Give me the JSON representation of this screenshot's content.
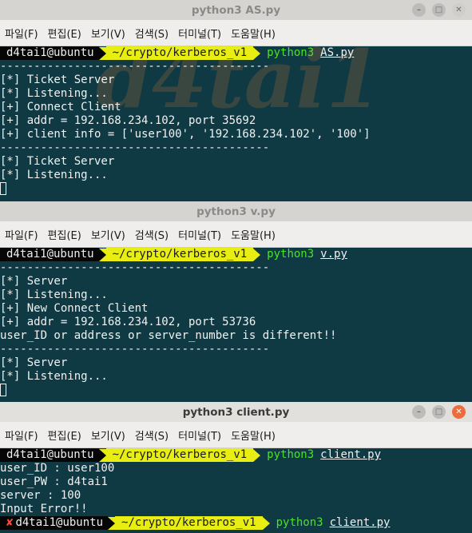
{
  "menu": [
    "파일(F)",
    "편집(E)",
    "보기(V)",
    "검색(S)",
    "터미널(T)",
    "도움말(H)"
  ],
  "windows": {
    "as": {
      "title": "python3 AS.py",
      "prompt": {
        "host": "d4tai1@ubuntu",
        "path": "~/crypto/kerberos_v1",
        "cmd": "python3",
        "arg": "AS.py"
      },
      "lines": [
        "----------------------------------------",
        "[*] Ticket Server",
        "[*] Listening...",
        "[+] Connect Client",
        "[+] addr = 192.168.234.102, port 35692",
        "[+] client info = ['user100', '192.168.234.102', '100']",
        "----------------------------------------",
        "[*] Ticket Server",
        "[*] Listening..."
      ]
    },
    "v": {
      "title": "python3 v.py",
      "prompt": {
        "host": "d4tai1@ubuntu",
        "path": "~/crypto/kerberos_v1",
        "cmd": "python3",
        "arg": "v.py"
      },
      "lines": [
        "----------------------------------------",
        "[*] Server",
        "[*] Listening...",
        "[+] New Connect Client",
        "[+] addr = 192.168.234.102, port 53736",
        "user_ID or address or server_number is different!!",
        "----------------------------------------",
        "[*] Server",
        "[*] Listening..."
      ]
    },
    "client": {
      "title": "python3 client.py",
      "prompt": {
        "host": "d4tai1@ubuntu",
        "path": "~/crypto/kerberos_v1",
        "cmd": "python3",
        "arg": "client.py"
      },
      "lines": [
        "user_ID : user100",
        "user_PW : d4tai1",
        "server : 100",
        "Input Error!!"
      ],
      "prompt2": {
        "x": "✘",
        "host": "d4tai1@ubuntu",
        "path": "~/crypto/kerberos_v1",
        "cmd": "python3",
        "arg": "client.py"
      }
    }
  }
}
